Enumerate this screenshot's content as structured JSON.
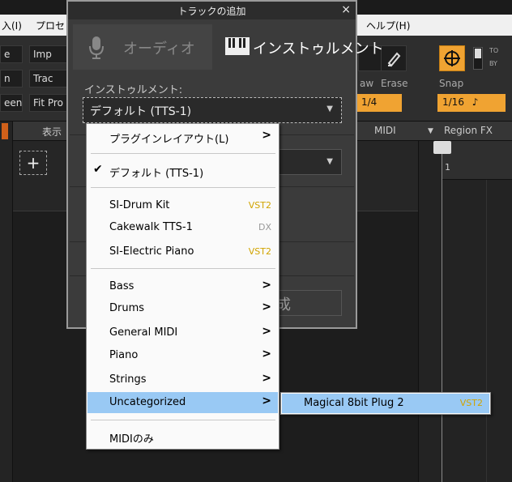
{
  "menubar": {
    "item1": "入(I)",
    "item2": "プロセ",
    "item3": "ヘルプ(H)"
  },
  "toolbar": {
    "btn_e": "e",
    "btn_imp": "Imp",
    "btn_n": "n",
    "btn_trac": "Trac",
    "btn_een": "een",
    "btn_fitpro": "Fit Pro",
    "label_aw": "aw",
    "label_erase": "Erase",
    "label_snap": "Snap",
    "quantize_value": "1/4",
    "snap_value": "1/16",
    "note_glyph": "♪",
    "to_label": "TO",
    "by_label": "BY"
  },
  "track_header": {
    "display": "表示",
    "midi": "MIDI",
    "region_fx": "Region FX",
    "ruler_number": "1"
  },
  "dialog": {
    "title": "トラックの追加",
    "close": "×",
    "tab_audio": "オーディオ",
    "tab_instrument": "インストゥルメント",
    "field_label": "インストゥルメント:",
    "selected_instrument": "デフォルト (TTS-1)",
    "create_partial": "成"
  },
  "context_menu": {
    "plugin_layout": "プラグインレイアウト(L)",
    "default": "デフォルト (TTS-1)",
    "instruments": [
      {
        "label": "SI-Drum Kit",
        "tag": "VST2"
      },
      {
        "label": "Cakewalk TTS-1",
        "tag": "DX"
      },
      {
        "label": "SI-Electric Piano",
        "tag": "VST2"
      }
    ],
    "categories": [
      "Bass",
      "Drums",
      "General MIDI",
      "Piano",
      "Strings",
      "Uncategorized"
    ],
    "midi_only": "MIDIのみ",
    "highlighted": "Uncategorized"
  },
  "submenu": {
    "item_label": "Magical 8bit Plug 2",
    "item_tag": "VST2"
  },
  "colors": {
    "accent": "#f0a332",
    "highlight": "#99c9f4",
    "vst_tag": "#d1a400"
  }
}
